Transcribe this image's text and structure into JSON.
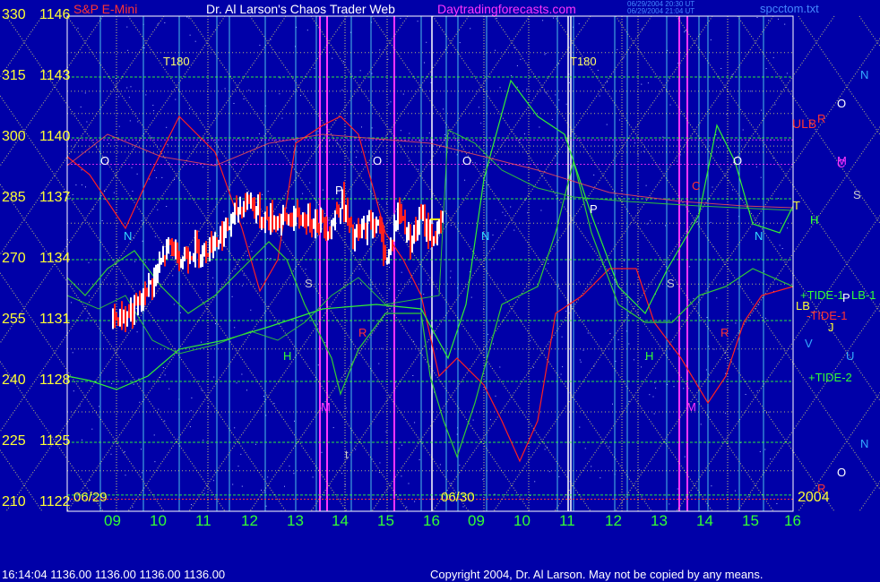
{
  "title": {
    "instrument": "S&P E-Mini",
    "main": "Dr. Al Larson's Chaos Trader Web",
    "site": "Daytradingforecasts.com",
    "stamp1": "06/29/2004 20:30 UT",
    "stamp2": "06/29/2004 21:04 UT",
    "file": "spcctom.txt"
  },
  "y_axis": {
    "ticks": [
      {
        "price": 1146,
        "left": "330",
        "right": "1146"
      },
      {
        "price": 1143,
        "left": "315",
        "right": "1143"
      },
      {
        "price": 1140,
        "left": "300",
        "right": "1140"
      },
      {
        "price": 1137,
        "left": "285",
        "right": "1137"
      },
      {
        "price": 1134,
        "left": "270",
        "right": "1134"
      },
      {
        "price": 1131,
        "left": "255",
        "right": "1131"
      },
      {
        "price": 1128,
        "left": "240",
        "right": "1128"
      },
      {
        "price": 1125,
        "left": "225",
        "right": "1125"
      },
      {
        "price": 1122,
        "left": "210",
        "right": "1122"
      }
    ]
  },
  "x_axis": {
    "hour_labels": [
      "09",
      "10",
      "11",
      "12",
      "13",
      "14",
      "15",
      "16",
      "09",
      "10",
      "11",
      "12",
      "13",
      "14",
      "15",
      "16"
    ],
    "date_labels": [
      "06/29",
      "06/30"
    ],
    "year_label": "2004"
  },
  "cycle_labels": {
    "t180": "T180",
    "ulb": "ULB",
    "lb": "LB",
    "tide": "+TIDE-1",
    "tide_neg": "-TIDE-1",
    "tide2": "+TIDE-2",
    "tide_lb": "LB-1",
    "t": "T",
    "h": "H"
  },
  "right_planets": [
    {
      "symbol": "N",
      "color": "#33aaff"
    },
    {
      "symbol": "O",
      "color": "#ffffff"
    },
    {
      "symbol": "R",
      "color": "#ff3333"
    },
    {
      "symbol": "M",
      "color": "#ff33ff"
    },
    {
      "symbol": "C",
      "color": "#ff33ff"
    },
    {
      "symbol": "S",
      "color": "#cccccc"
    },
    {
      "symbol": "H",
      "color": "#33ff33"
    },
    {
      "symbol": "P",
      "color": "#ffffff"
    },
    {
      "symbol": "J",
      "color": "#ffff33"
    },
    {
      "symbol": "V",
      "color": "#33aaff"
    },
    {
      "symbol": "U",
      "color": "#33aaff"
    },
    {
      "symbol": "N",
      "color": "#33aaff"
    },
    {
      "symbol": "O",
      "color": "#ffffff"
    },
    {
      "symbol": "R",
      "color": "#ff3333"
    }
  ],
  "in_chart_markers": [
    {
      "symbol": "O",
      "color": "#ffffff"
    },
    {
      "symbol": "N",
      "color": "#33ddff"
    },
    {
      "symbol": "S",
      "color": "#cccccc"
    },
    {
      "symbol": "H",
      "color": "#33ff33"
    },
    {
      "symbol": "M",
      "color": "#ff33ff"
    },
    {
      "symbol": "O",
      "color": "#ffffff"
    },
    {
      "symbol": "R",
      "color": "#ff3333"
    },
    {
      "symbol": "P",
      "color": "#ffffff"
    },
    {
      "symbol": "O",
      "color": "#ffffff"
    },
    {
      "symbol": "N",
      "color": "#33ddff"
    },
    {
      "symbol": "P",
      "color": "#ffffff"
    },
    {
      "symbol": "H",
      "color": "#33ff33"
    },
    {
      "symbol": "S",
      "color": "#cccccc"
    },
    {
      "symbol": "M",
      "color": "#ff33ff"
    },
    {
      "symbol": "R",
      "color": "#ff3333"
    },
    {
      "symbol": "O",
      "color": "#ffffff"
    },
    {
      "symbol": "N",
      "color": "#33ddff"
    },
    {
      "symbol": "C",
      "color": "#ff3333"
    },
    {
      "symbol": "t",
      "color": "#cccccc"
    }
  ],
  "footer": {
    "quote": "16:14:04  1136.00 1136.00 1136.00 1136.00",
    "copyright": "Copyright 2004, Dr. Al Larson. May not be copied by any means."
  },
  "colors": {
    "background": "#0000a8",
    "price_up": "#ffffff",
    "price_down": "#ff2020",
    "grid_cyan": "#66ffff",
    "grid_yellow": "#ffff66",
    "grid_green": "#33ff33",
    "grid_magenta": "#ff33ff",
    "line_red": "#ff2020",
    "line_green": "#33cc33"
  },
  "chart_data": {
    "type": "candlestick",
    "title": "S&P E-Mini",
    "x": [
      "06/29 09",
      "06/29 10",
      "06/29 11",
      "06/29 12",
      "06/29 13",
      "06/29 14",
      "06/29 15",
      "06/29 16",
      "06/30 09",
      "06/30 10",
      "06/30 11",
      "06/30 12",
      "06/30 13",
      "06/30 14",
      "06/30 15",
      "06/30 16"
    ],
    "ylim": [
      1122,
      1146
    ],
    "price_series": {
      "name": "S&P E-Mini",
      "x": [
        "09:00",
        "09:30",
        "10:00",
        "10:15",
        "10:30",
        "10:45",
        "11:00",
        "11:15",
        "11:30",
        "11:45",
        "12:00",
        "12:15",
        "12:30",
        "12:45",
        "13:00",
        "13:15",
        "13:30",
        "13:45",
        "14:00",
        "14:15",
        "14:30",
        "14:45",
        "15:00",
        "15:15",
        "15:30",
        "15:45",
        "16:00",
        "16:14"
      ],
      "close": [
        1131.0,
        1131.5,
        1133.5,
        1134.8,
        1134.0,
        1134.5,
        1134.5,
        1135.0,
        1135.5,
        1136.5,
        1137.0,
        1136.0,
        1136.0,
        1136.0,
        1136.0,
        1136.0,
        1136.0,
        1135.5,
        1137.0,
        1135.0,
        1135.5,
        1136.0,
        1134.0,
        1136.5,
        1135.0,
        1136.0,
        1135.0,
        1136.0
      ]
    },
    "series": [
      {
        "name": "+TIDE-1",
        "color": "#33ff33"
      },
      {
        "name": "-TIDE-1",
        "color": "#ff2020"
      },
      {
        "name": "+TIDE-2",
        "color": "#33ff33"
      },
      {
        "name": "LB-1",
        "color": "#33ff33"
      },
      {
        "name": "ULB",
        "color": "#ff2020"
      }
    ],
    "annotations": [
      "T180",
      "T180",
      "ULB",
      "LB",
      "T",
      "H"
    ],
    "grid": true
  }
}
